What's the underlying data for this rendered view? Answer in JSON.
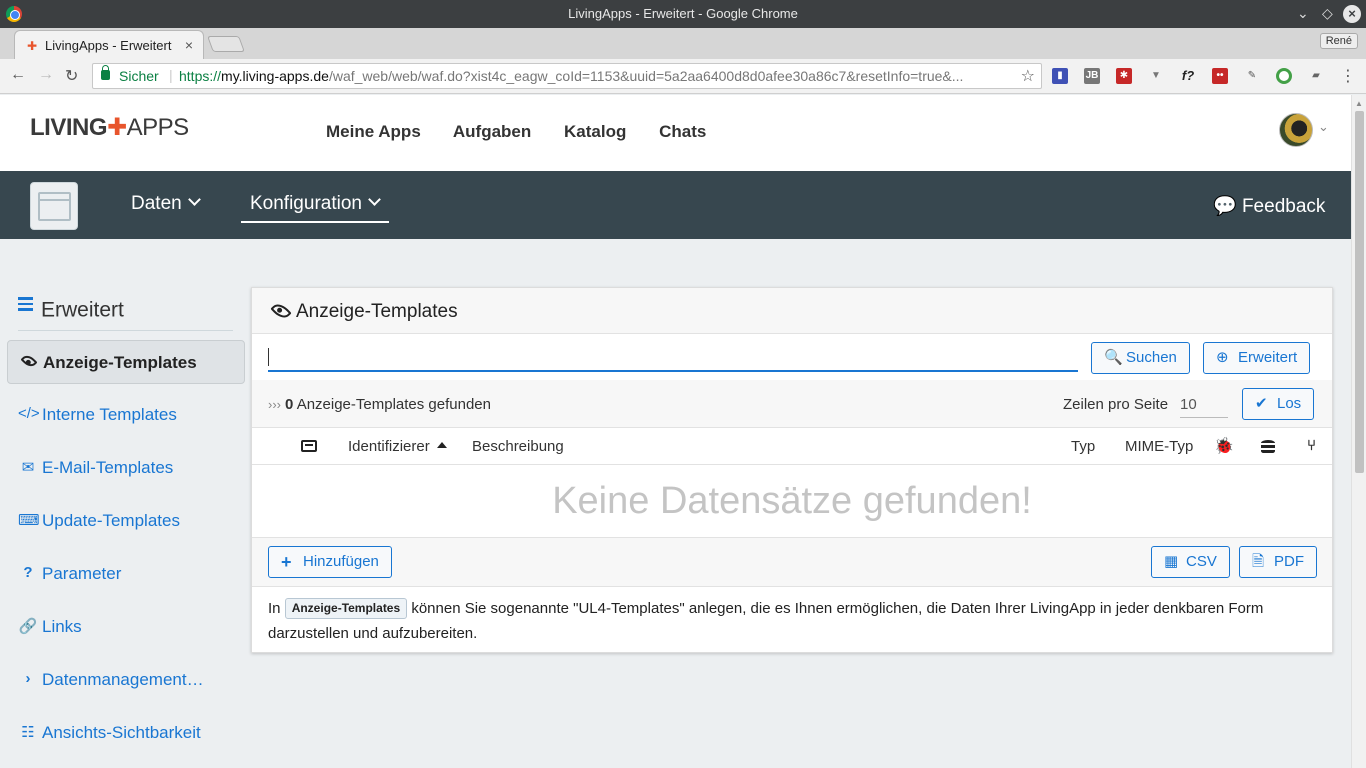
{
  "browser": {
    "window_title": "LivingApps - Erweitert - Google Chrome",
    "tab_title": "LivingApps - Erweitert",
    "profile": "René",
    "security_label": "Sicher",
    "url_scheme": "https://",
    "url_host": "my.living-apps.de",
    "url_path": "/waf_web/web/waf.do?xist4c_eagw_coId=1153&uuid=5a2aa6400d8d0afee30a86c7&resetInfo=true&..."
  },
  "site": {
    "logo_left": "LIVING",
    "logo_right": "APPS",
    "nav": [
      "Meine Apps",
      "Aufgaben",
      "Katalog",
      "Chats"
    ]
  },
  "appbar": {
    "data_menu": "Daten",
    "config_menu": "Konfiguration",
    "feedback": "Feedback"
  },
  "sidebar": {
    "title": "Erweitert",
    "items": [
      {
        "label": "Anzeige-Templates",
        "icon": "eye-icon"
      },
      {
        "label": "Interne Templates",
        "icon": "code-icon"
      },
      {
        "label": "E-Mail-Templates",
        "icon": "envelope-icon"
      },
      {
        "label": "Update-Templates",
        "icon": "keyboard-icon"
      },
      {
        "label": "Parameter",
        "icon": "question-icon"
      },
      {
        "label": "Links",
        "icon": "link-icon"
      },
      {
        "label": "Datenmanagement…",
        "icon": "chevron-right-icon"
      },
      {
        "label": "Ansichts-Sichtbarkeit",
        "icon": "list-alt-icon"
      }
    ]
  },
  "panel": {
    "title": "Anzeige-Templates",
    "search_value": "",
    "search_button": "Suchen",
    "advanced_button": "Erweitert",
    "found_count": "0",
    "found_text": "Anzeige-Templates gefunden",
    "rows_per_page_label": "Zeilen pro Seite",
    "rows_per_page_value": "10",
    "go_button": "Los",
    "columns": {
      "identifier": "Identifizierer",
      "description": "Beschreibung",
      "type": "Typ",
      "mime": "MIME-Typ"
    },
    "empty_message": "Keine Datensätze gefunden!",
    "add_button": "Hinzufügen",
    "csv_button": "CSV",
    "pdf_button": "PDF",
    "info_before": "In",
    "info_badge": "Anzeige-Templates",
    "info_after": "können Sie sogenannte \"UL4-Templates\" anlegen, die es Ihnen ermöglichen, die Daten Ihrer LivingApp in jeder denkbaren Form darzustellen und aufzubereiten."
  }
}
